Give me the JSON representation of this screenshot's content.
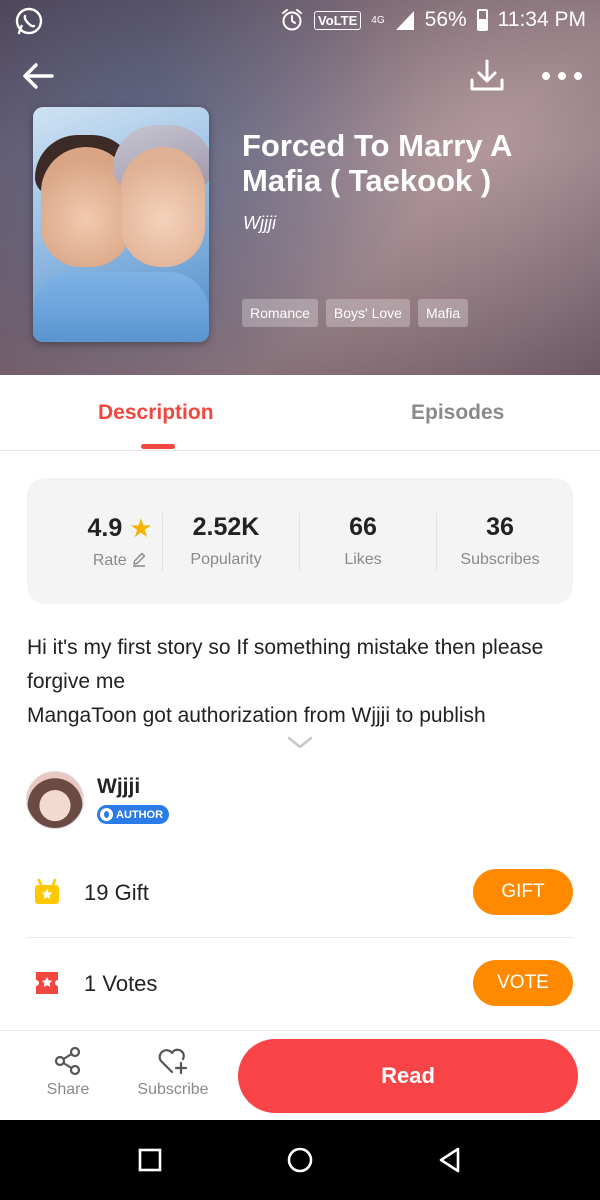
{
  "status_bar": {
    "network": "VoLTE",
    "signal": "4G",
    "battery": "56%",
    "time": "11:34 PM"
  },
  "book": {
    "title": "Forced To Marry A Mafia ( Taekook )",
    "author": "Wjjji",
    "tags": [
      "Romance",
      "Boys' Love",
      "Mafia"
    ]
  },
  "tabs": {
    "description": "Description",
    "episodes": "Episodes"
  },
  "stats": {
    "rate": {
      "value": "4.9",
      "label": "Rate"
    },
    "popularity": {
      "value": "2.52K",
      "label": "Popularity"
    },
    "likes": {
      "value": "66",
      "label": "Likes"
    },
    "subscribes": {
      "value": "36",
      "label": "Subscribes"
    }
  },
  "description": {
    "line1": "Hi it's my first story so If something mistake then please forgive me",
    "line2": "MangaToon got authorization from Wjjji to publish"
  },
  "author": {
    "name": "Wjjji",
    "badge": "AUTHOR"
  },
  "gift": {
    "count": "19",
    "label": "Gift",
    "button": "GIFT"
  },
  "votes": {
    "count": "1",
    "label": "Votes",
    "button": "VOTE"
  },
  "bottom_bar": {
    "share": "Share",
    "subscribe": "Subscribe",
    "read": "Read"
  },
  "colors": {
    "accent_red": "#f2473f",
    "read_button": "#f84447",
    "orange_button": "#ff8a00",
    "star": "#f7b500",
    "author_badge": "#2b7be8"
  }
}
